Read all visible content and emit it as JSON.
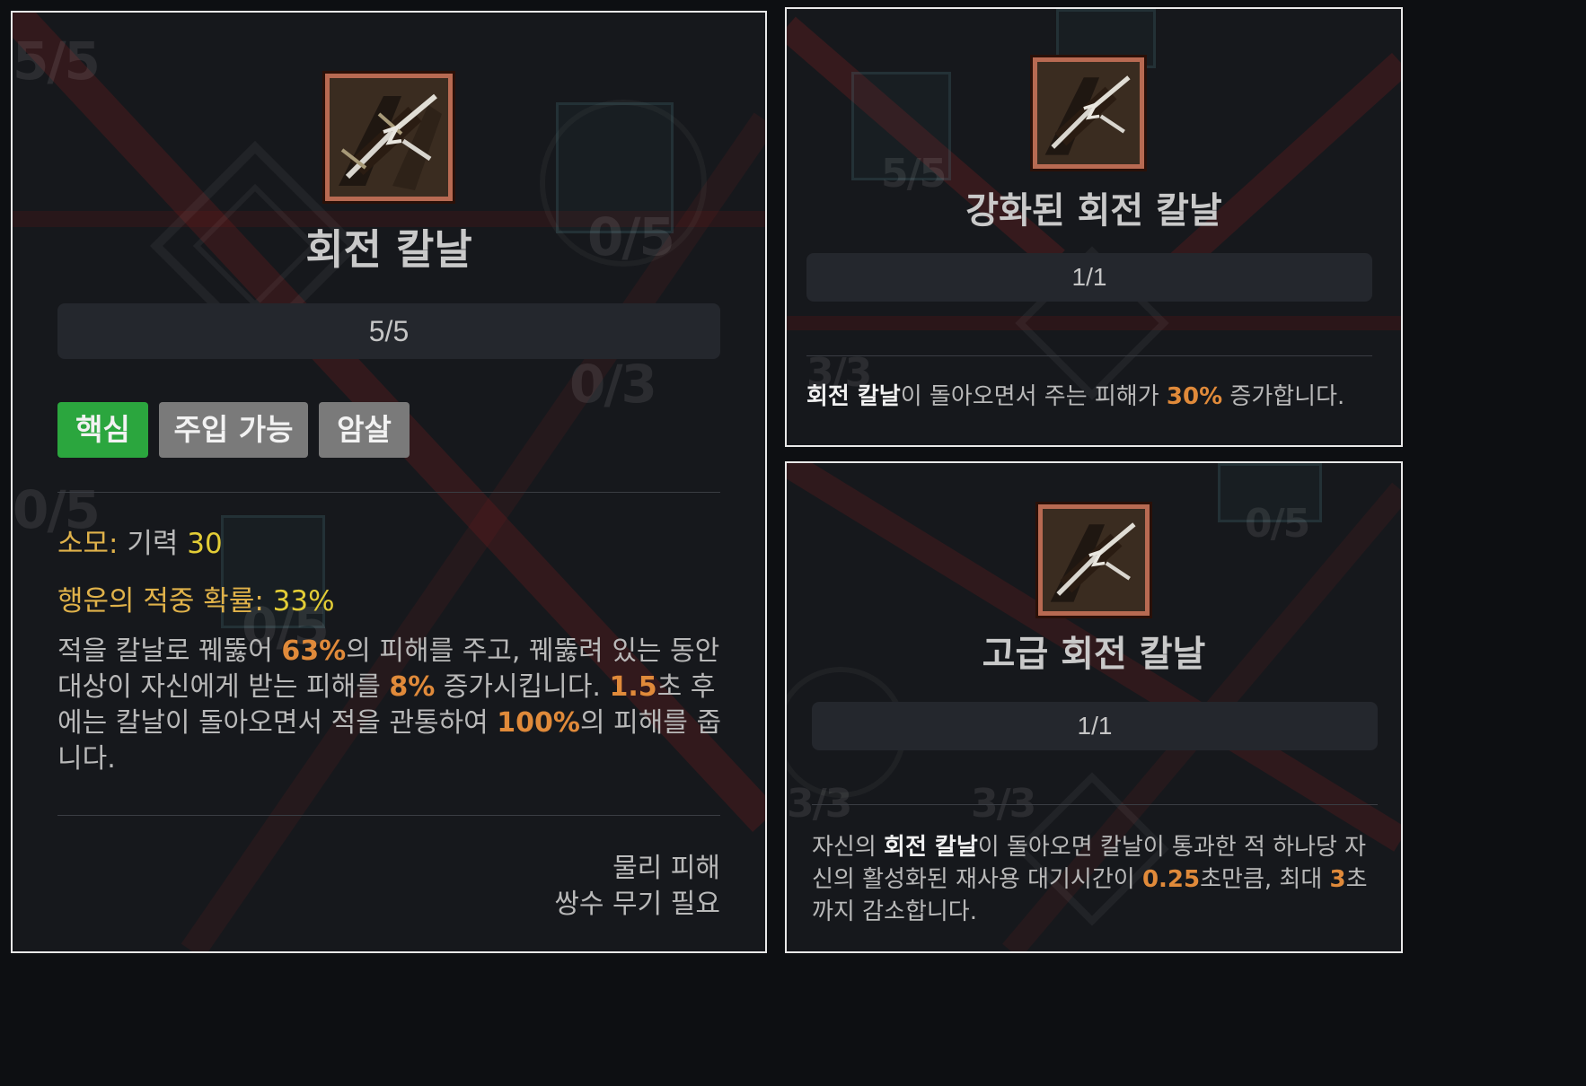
{
  "left_panel": {
    "skill_name": "회전 칼날",
    "rank": "5/5",
    "tags": [
      "핵심",
      "주입 가능",
      "암살"
    ],
    "cost_label": "소모:",
    "cost_resource": "기력",
    "cost_value": "30",
    "lucky_label": "행운의 적중 확률:",
    "lucky_value": "33%",
    "description": {
      "p1": "적을 칼날로 꿰뚫어 ",
      "v1": "63%",
      "p2": "의 피해를 주고, 꿰뚫려 있는 동안 대상이 자신에게 받는 피해를 ",
      "v2": "8%",
      "p3": " 증가시킵니다. ",
      "v3": "1.5",
      "p4": "초 후에는 칼날이 돌아오면서 적을 관통하여 ",
      "v4": "100%",
      "p5": "의 피해를 줍니다."
    },
    "footer_line1": "물리 피해",
    "footer_line2": "쌍수 무기 필요",
    "ghost_texts": [
      "5/5",
      "0/5",
      "0/3",
      "0/5",
      "0/5"
    ]
  },
  "top_right_panel": {
    "skill_name": "강화된 회전 칼날",
    "rank": "1/1",
    "description": {
      "b1": "회전 칼날",
      "p1": "이 돌아오면서 주는 피해가 ",
      "v1": "30%",
      "p2": " 증가합니다."
    },
    "ghost_texts": [
      "5/5",
      "3/3"
    ]
  },
  "bottom_right_panel": {
    "skill_name": "고급 회전 칼날",
    "rank": "1/1",
    "description": {
      "p0": "자신의 ",
      "b1": "회전 칼날",
      "p1": "이 돌아오면 칼날이 통과한 적 하나당 자신의 활성화된 재사용 대기시간이 ",
      "v1": "0.25",
      "p2": "초만큼, 최대 ",
      "v2": "3",
      "p3": "초까지 감소합니다."
    },
    "ghost_texts": [
      "0/5",
      "3/3",
      "3/3"
    ]
  },
  "colors": {
    "core_tag": "#2ba63e",
    "gray_tag": "#7a7a7a",
    "orange_value": "#e08a3a",
    "yellow_value": "#e3cd36",
    "gold_label": "#e0b24a",
    "icon_border": "#b86a52"
  },
  "icons": {
    "skill_icon": "twin-daggers-icon"
  }
}
